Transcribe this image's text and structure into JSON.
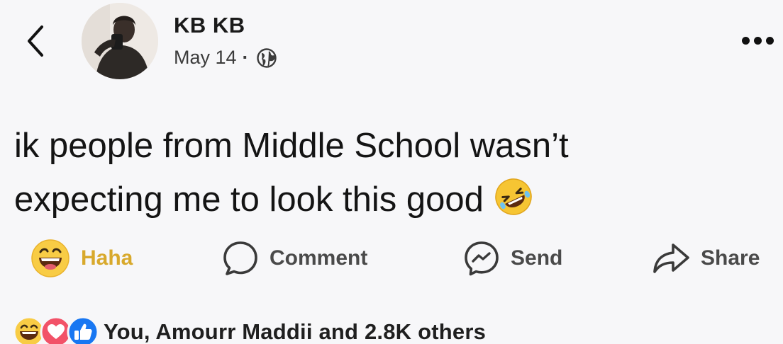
{
  "post": {
    "author": "KB KB",
    "date": "May 14",
    "separator": "·",
    "audience_icon": "globe-icon",
    "text_line1": "ik people from Middle School wasn’t",
    "text_line2": "expecting me to look this good",
    "emoji": "rolling-on-floor-laughing-emoji"
  },
  "actions": {
    "reaction_label": "Haha",
    "comment_label": "Comment",
    "send_label": "Send",
    "share_label": "Share"
  },
  "reactions": {
    "icons": [
      "haha-icon",
      "love-icon",
      "like-icon"
    ],
    "summary": "You, Amourr Maddii and 2.8K others"
  },
  "colors": {
    "haha": "#d8a92c",
    "love": "#f25268",
    "like": "#1877f2",
    "background": "#f7f7f9"
  }
}
